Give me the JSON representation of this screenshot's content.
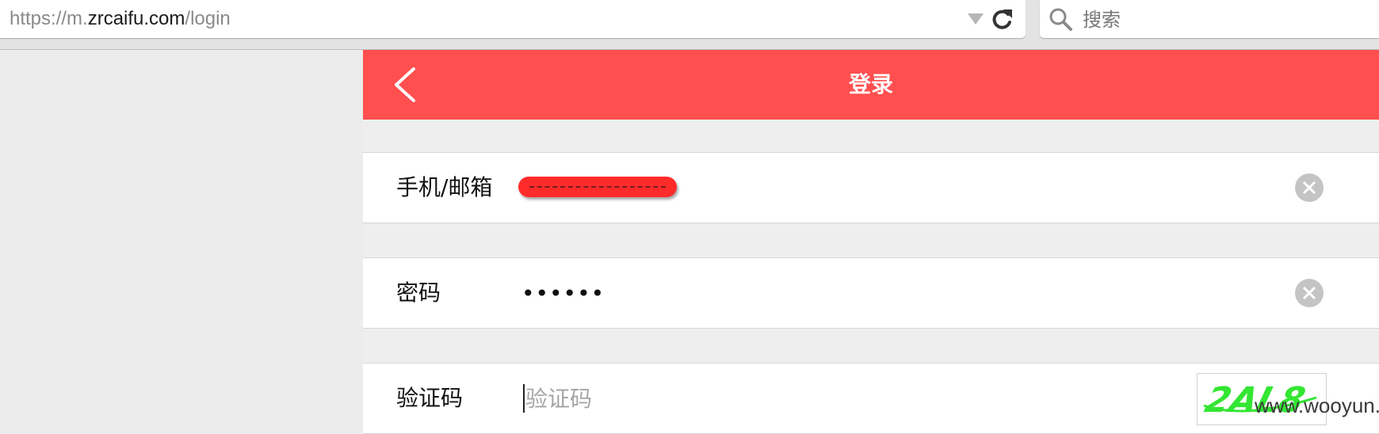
{
  "browser": {
    "url_prefix": "https://m.",
    "url_host": "zrcaifu.com",
    "url_path": "/login",
    "search_placeholder": "搜索",
    "icons": [
      "dropdown-icon",
      "reload-icon",
      "search-icon"
    ]
  },
  "header": {
    "title": "登录",
    "back_icon": "chevron-left-icon",
    "background": "#ff4f4f"
  },
  "form": {
    "account": {
      "label": "手机/邮箱",
      "value_redacted": true,
      "clear_icon": "close-circle-icon"
    },
    "password": {
      "label": "密码",
      "value": "••••••",
      "clear_icon": "close-circle-icon"
    },
    "captcha": {
      "label": "验证码",
      "placeholder": "验证码",
      "value": "",
      "image_text": "2AL8"
    }
  },
  "watermark": "www.wooyun.org"
}
